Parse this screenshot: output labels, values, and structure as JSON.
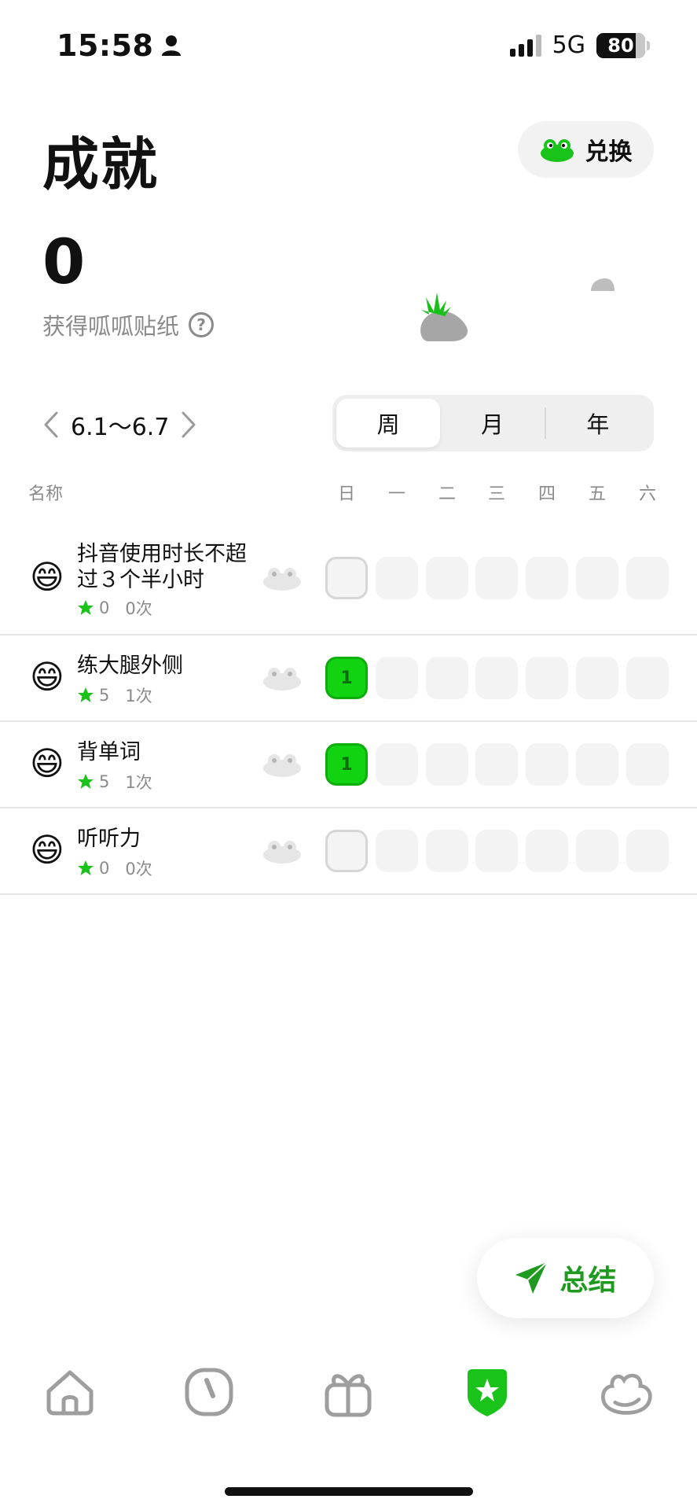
{
  "status_bar": {
    "time": "15:58",
    "network": "5G",
    "battery": "80"
  },
  "header": {
    "title": "成就",
    "exchange_label": "兑换"
  },
  "summary_count": {
    "value": "0",
    "caption": "获得呱呱贴纸",
    "help": "?"
  },
  "date_nav": {
    "range": "6.1～6.7"
  },
  "segments": [
    {
      "label": "周",
      "active": true
    },
    {
      "label": "月",
      "active": false
    },
    {
      "label": "年",
      "active": false
    }
  ],
  "table": {
    "name_header": "名称",
    "days": [
      "日",
      "一",
      "二",
      "三",
      "四",
      "五",
      "六"
    ],
    "rows": [
      {
        "emoji": "😄",
        "name": "抖音使用时长不超过３个半小时",
        "stars": "0",
        "times": "0次",
        "cells": [
          "",
          "",
          "",
          "",
          "",
          "",
          ""
        ]
      },
      {
        "emoji": "😄",
        "name": "练大腿外侧",
        "stars": "5",
        "times": "1次",
        "cells": [
          "1",
          "",
          "",
          "",
          "",
          "",
          ""
        ]
      },
      {
        "emoji": "😄",
        "name": "背单词",
        "stars": "5",
        "times": "1次",
        "cells": [
          "1",
          "",
          "",
          "",
          "",
          "",
          ""
        ]
      },
      {
        "emoji": "😄",
        "name": "听听力",
        "stars": "0",
        "times": "0次",
        "cells": [
          "",
          "",
          "",
          "",
          "",
          "",
          ""
        ]
      }
    ]
  },
  "summary_button": {
    "label": "总结"
  },
  "tab_bar": {
    "items": [
      {
        "icon": "home-icon",
        "active": false
      },
      {
        "icon": "timer-icon",
        "active": false
      },
      {
        "icon": "gift-icon",
        "active": false
      },
      {
        "icon": "achievement-badge-icon",
        "active": true
      },
      {
        "icon": "frog-icon",
        "active": false
      }
    ]
  },
  "colors": {
    "accent_green": "#12d312",
    "text_green": "#1e9a1e",
    "muted": "#8a8a8a"
  }
}
